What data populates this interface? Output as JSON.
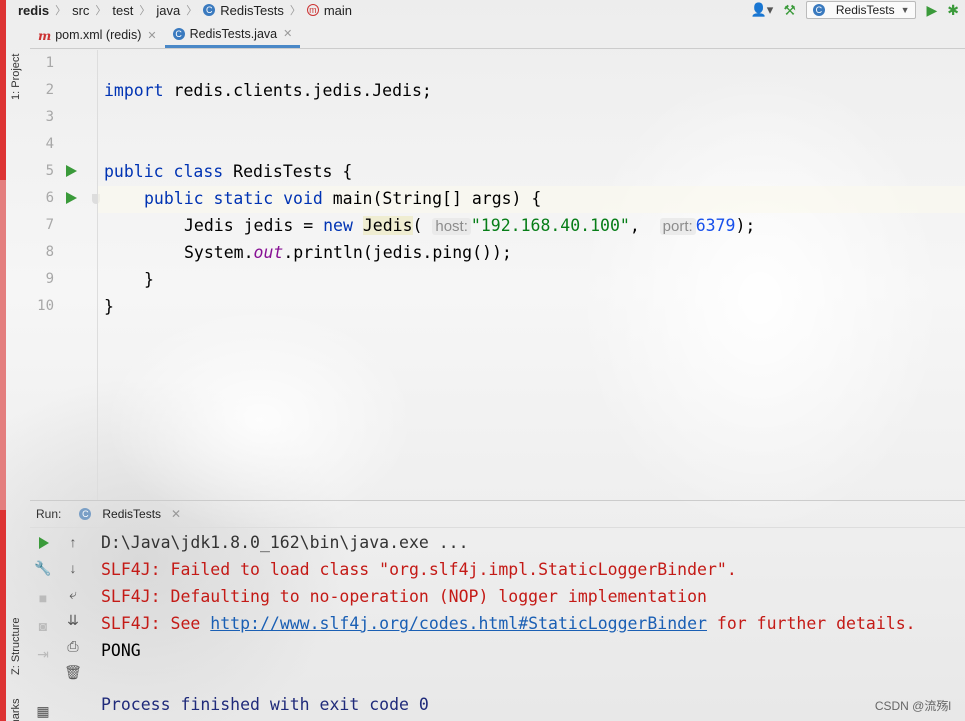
{
  "breadcrumb": {
    "project": "redis",
    "items": [
      "src",
      "test",
      "java"
    ],
    "class_name": "RedisTests",
    "method_name": "main"
  },
  "toolbar": {
    "run_config": "RedisTests"
  },
  "sidebar": {
    "project_label": "1: Project",
    "structure_label": "Z: Structure",
    "bookmarks_label": "okmarks"
  },
  "tabs": [
    {
      "label": "pom.xml (redis)",
      "active": false
    },
    {
      "label": "RedisTests.java",
      "active": true
    }
  ],
  "editor": {
    "line_numbers": [
      "1",
      "2",
      "3",
      "4",
      "5",
      "6",
      "7",
      "8",
      "9",
      "10"
    ],
    "code": {
      "l2_kw": "import",
      "l2_rest": " redis.clients.jedis.Jedis;",
      "l5_kw": "public class",
      "l5_rest": " RedisTests {",
      "l6_kw": "public static void",
      "l6_rest": " main(String[] args) {",
      "l7_a": "Jedis jedis = ",
      "l7_new": "new",
      "l7_ctor": "Jedis",
      "l7_paren": "(",
      "l7_hint_host": "host:",
      "l7_host": "\"192.168.40.100\"",
      "l7_comma": ",",
      "l7_hint_port": "port:",
      "l7_port": "6379",
      "l7_end": ");",
      "l8_a": "System.",
      "l8_out": "out",
      "l8_b": ".println(jedis.ping());",
      "l9": "}",
      "l10": "}"
    }
  },
  "run": {
    "label": "Run:",
    "tab_label": "RedisTests",
    "console": {
      "cmd": "D:\\Java\\jdk1.8.0_162\\bin\\java.exe ...",
      "err1": "SLF4J: Failed to load class \"org.slf4j.impl.StaticLoggerBinder\".",
      "err2": "SLF4J: Defaulting to no-operation (NOP) logger implementation",
      "err3_a": "SLF4J: See ",
      "err3_link": "http://www.slf4j.org/codes.html#StaticLoggerBinder",
      "err3_b": " for further details.",
      "out": "PONG",
      "exit": "Process finished with exit code 0"
    }
  },
  "watermark": "CSDN @流殇l",
  "colors": {
    "keyword": "#0033b3",
    "string": "#067d17",
    "number": "#1750eb",
    "error": "#c41a16",
    "run_green": "#3a9a3a"
  }
}
